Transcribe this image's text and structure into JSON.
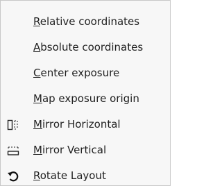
{
  "menu": {
    "items": [
      {
        "label": "Relative coordinates",
        "mnemonic": "R",
        "rest": "elative coordinates",
        "icon": null
      },
      {
        "label": "Absolute coordinates",
        "mnemonic": "A",
        "rest": "bsolute coordinates",
        "icon": null
      },
      {
        "label": "Center exposure",
        "mnemonic": "C",
        "rest": "enter exposure",
        "icon": null
      },
      {
        "label": "Map exposure origin",
        "mnemonic": "M",
        "rest": "ap exposure origin",
        "icon": null
      },
      {
        "label": "Mirror Horizontal",
        "mnemonic": "M",
        "rest": "irror Horizontal",
        "icon": "mirror-horizontal-icon"
      },
      {
        "label": "Mirror Vertical",
        "mnemonic": "M",
        "rest": "irror Vertical",
        "icon": "mirror-vertical-icon"
      },
      {
        "label": "Rotate Layout",
        "mnemonic": "R",
        "rest": "otate Layout",
        "icon": "rotate-layout-icon"
      }
    ]
  }
}
